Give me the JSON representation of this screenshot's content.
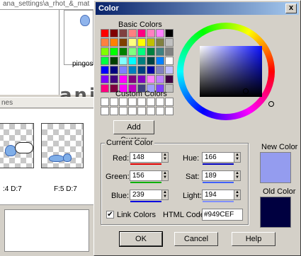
{
  "background_app": {
    "top_strip_text": "ana_settings\\a_rhot_&_mat",
    "thumbnail_label": "pingos",
    "watermark": "animation",
    "frames_header": "nes",
    "frames": [
      {
        "label": ":4  D:7"
      },
      {
        "label": "F:5  D:7"
      }
    ]
  },
  "dialog": {
    "title": "Color",
    "close_glyph": "x",
    "basic_colors_label": "Basic Colors",
    "custom_colors_label": "Custom Colors",
    "add_custom_label": "Add Custom",
    "basic_colors": [
      "#ff0000",
      "#800000",
      "#804040",
      "#ff8080",
      "#ff0080",
      "#ff80c0",
      "#ff80ff",
      "#000000",
      "#ff8040",
      "#ff8000",
      "#804000",
      "#ffff80",
      "#ffff00",
      "#c0c000",
      "#808040",
      "#c0c0c0",
      "#80ff00",
      "#00ff00",
      "#008000",
      "#80ff80",
      "#00ff80",
      "#008040",
      "#408080",
      "#808080",
      "#00ff40",
      "#004000",
      "#80ffff",
      "#00ffff",
      "#008080",
      "#004040",
      "#0080ff",
      "#ffffff",
      "#0000ff",
      "#000080",
      "#8080ff",
      "#0080c0",
      "#004080",
      "#0000a0",
      "#8080c0",
      "#c0c0ff",
      "#8000ff",
      "#400080",
      "#ff00ff",
      "#800080",
      "#8000c0",
      "#ff80ff",
      "#c080ff",
      "#400040",
      "#ff0080",
      "#800040",
      "#ff00ff",
      "#c000c0",
      "#404080",
      "#a0a0ff",
      "#8040ff",
      "#c0c0c0"
    ],
    "current_color_label": "Current Color",
    "fields": {
      "red": {
        "label": "Red:",
        "value": "148"
      },
      "green": {
        "label": "Green:",
        "value": "156"
      },
      "blue": {
        "label": "Blue:",
        "value": "239"
      },
      "hue": {
        "label": "Hue:",
        "value": "166"
      },
      "sat": {
        "label": "Sat:",
        "value": "189"
      },
      "light": {
        "label": "Light:",
        "value": "194"
      }
    },
    "link_colors_label": "Link Colors",
    "link_colors_checked": true,
    "check_glyph": "✔",
    "html_code_label": "HTML Code:",
    "html_code_value": "#949CEF",
    "new_color_label": "New Color",
    "new_color": "#949cef",
    "old_color_label": "Old Color",
    "old_color": "#000040",
    "ok_label": "OK",
    "cancel_label": "Cancel",
    "help_label": "Help"
  }
}
